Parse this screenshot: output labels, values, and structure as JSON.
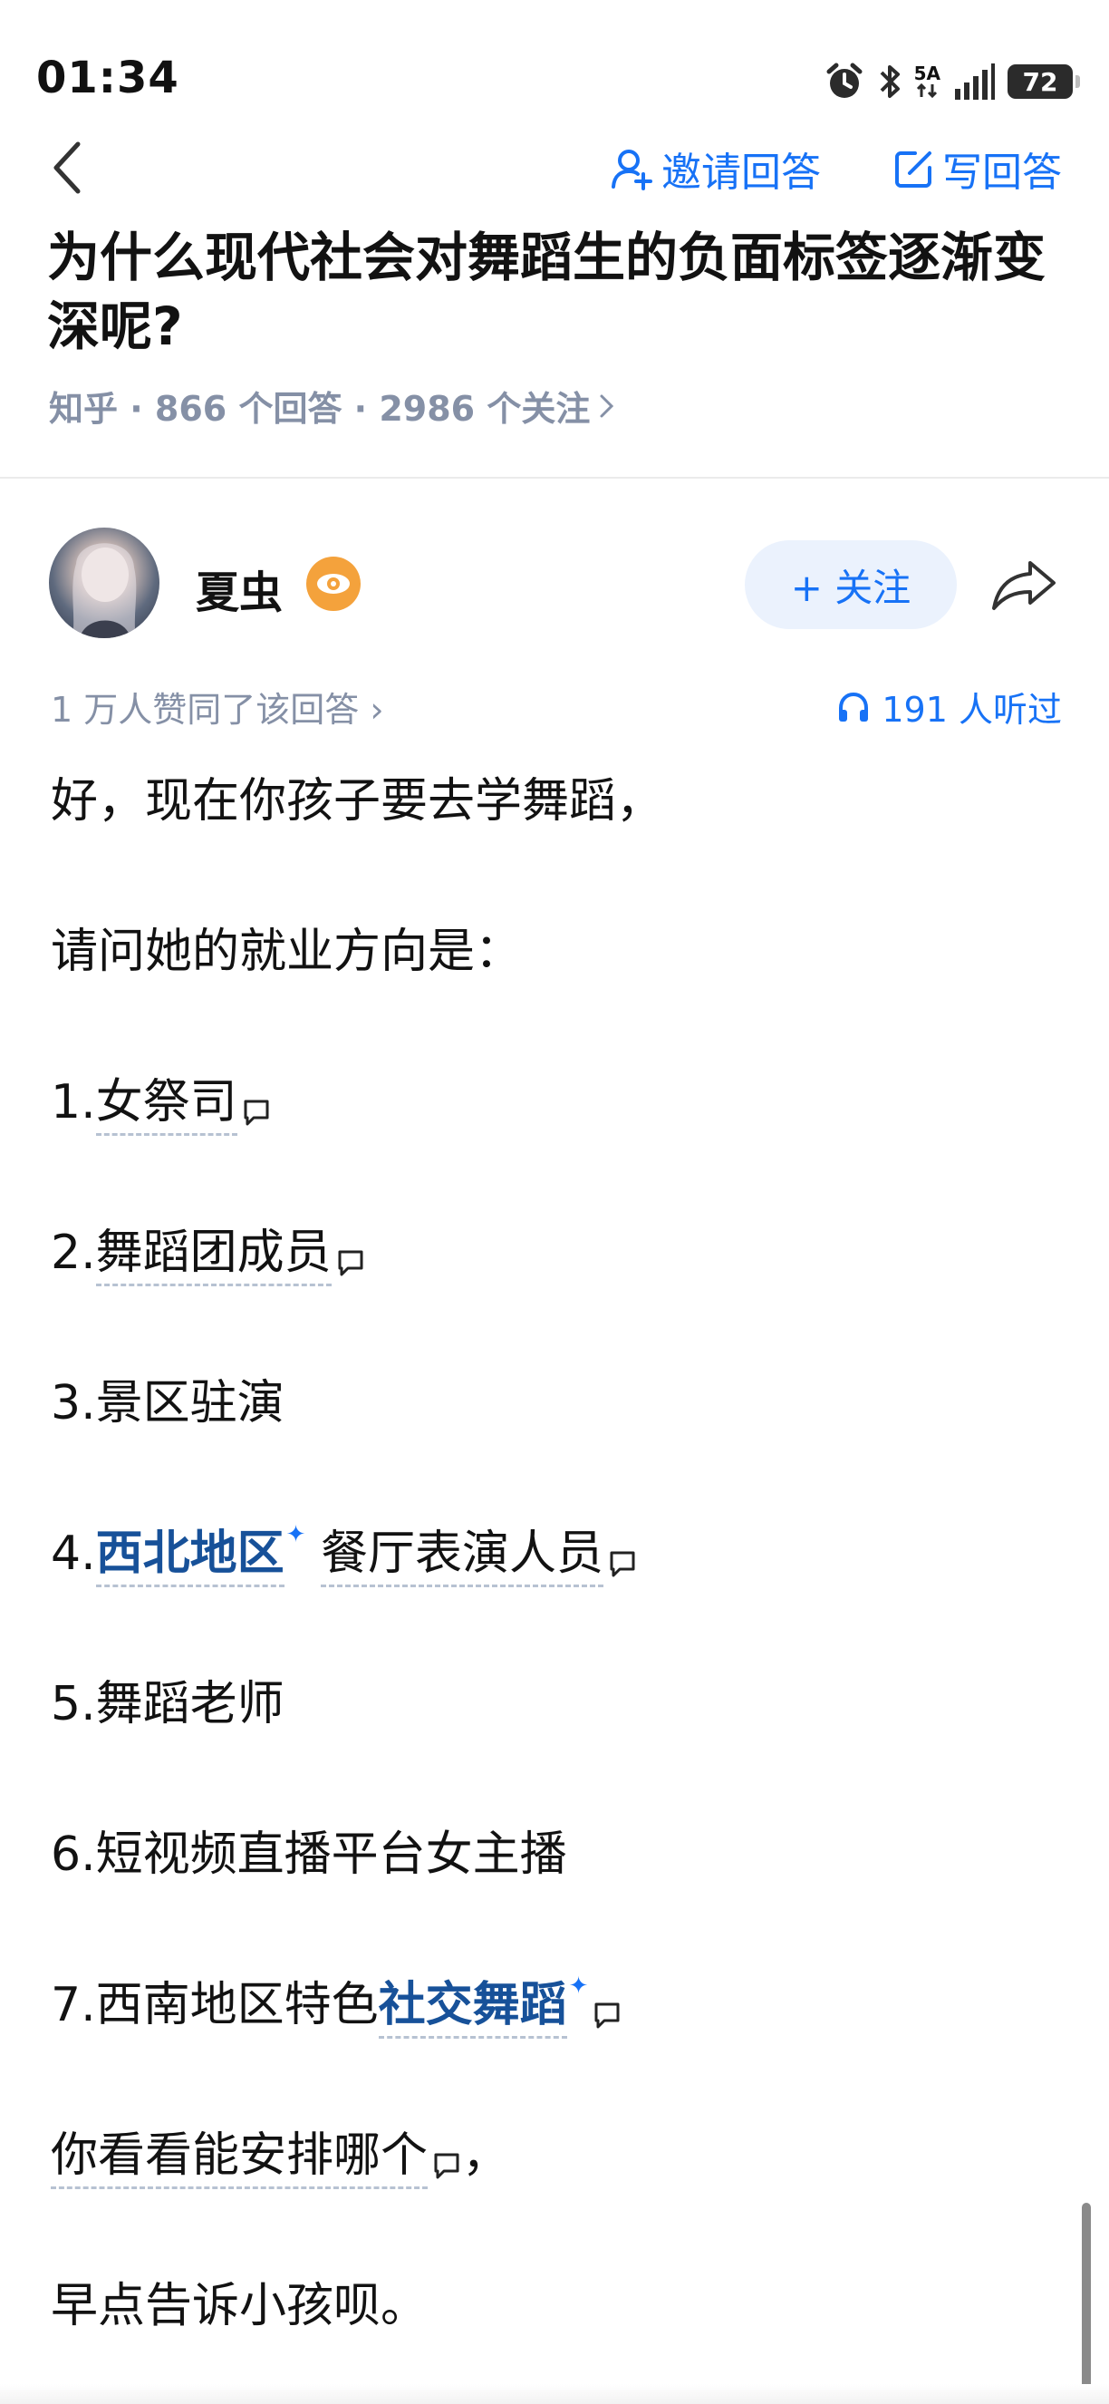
{
  "status_bar": {
    "time": "01:34",
    "signal_label": "5A",
    "battery": "72"
  },
  "header": {
    "invite_label": "邀请回答",
    "write_label": "写回答"
  },
  "question": {
    "title": "为什么现代社会对舞蹈生的负面标签逐渐变深呢?",
    "meta": "知乎 · 866 个回答 · 2986 个关注"
  },
  "author": {
    "name": "夏虫",
    "follow_label": "+ 关注"
  },
  "stats": {
    "upvote_text": "1 万人赞同了该回答",
    "listen_text": "191 人听过"
  },
  "answer": {
    "line1": "好，现在你孩子要去学舞蹈，",
    "line2": "请问她的就业方向是：",
    "item1_prefix": "1.",
    "item1": "女祭司",
    "item2_prefix": "2.",
    "item2": "舞蹈团成员",
    "item3": "3.景区驻演",
    "item4_prefix": "4.",
    "item4_keyword": "西北地区",
    "item4_rest": "餐厅表演人员",
    "item5": "5.舞蹈老师",
    "item6": "6.短视频直播平台女主播",
    "item7_prefix": "7.西南地区特色",
    "item7_keyword": "社交舞蹈",
    "line_q": "你看看能安排哪个",
    "line_q_punct": "，",
    "line_last": "早点告诉小孩呗。"
  },
  "colors": {
    "accent": "#1772f6",
    "keyword": "#175199",
    "meta_gray": "#8590a6"
  }
}
